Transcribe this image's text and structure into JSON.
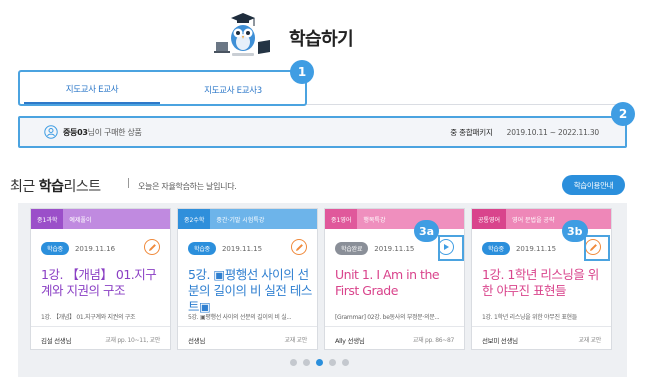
{
  "header": {
    "title": "학습하기",
    "mascot_icon": "owl-graduate-icon"
  },
  "tabs": [
    {
      "label": "지도교사 E교사",
      "active": true
    },
    {
      "label": "지도교사 E교사3",
      "active": false
    }
  ],
  "callouts": {
    "c1": "1",
    "c2": "2",
    "c3a": "3a",
    "c3b": "3b"
  },
  "info_bar": {
    "user_name": "중등03",
    "user_suffix": "님이 구매한 상품",
    "package": "중 종합패키지",
    "period": "2019.10.11 ~ 2022.11.30"
  },
  "section": {
    "title_prefix": "최근 ",
    "title_bold": "학습",
    "title_suffix": "리스트",
    "subtitle": "오늘은 자율학습하는 날입니다.",
    "guide_button": "학습이용안내"
  },
  "cards": [
    {
      "subject": "중1과학",
      "topic": "예제풀이",
      "subject_color": "#9b4fc9",
      "topic_color": "#c08ae0",
      "badge": "학습중",
      "badge_color": "#2b8fdc",
      "date": "2019.11.16",
      "action_icon": "pencil-icon",
      "title": "1강. 【개념】 01.지구계와 지권의 구조",
      "title_color": "#8a3fc4",
      "desc": "1강. 【개념】 01.지구계와 지권의 구조",
      "teacher": "김설 선생님",
      "pages": "교재 pp. 10~11, 교안"
    },
    {
      "subject": "중2수학",
      "topic": "중간·기말 시험특강",
      "subject_color": "#2f8fdb",
      "topic_color": "#6db4ea",
      "badge": "학습중",
      "badge_color": "#2b8fdc",
      "date": "2019.11.15",
      "action_icon": "pencil-icon",
      "title": "5강. ▣평행선 사이의 선분의 길이의 비 실전 테스트▣",
      "title_color": "#2f7fd0",
      "desc": "5강. ▣평행선 사이의 선분의 길이의 비 실...",
      "teacher": "선생님",
      "pages": "교재 교안"
    },
    {
      "subject": "중1영어",
      "topic": "행복특강",
      "subject_color": "#e0589b",
      "topic_color": "#ef8fbe",
      "badge": "학습완료",
      "badge_color": "#8a8f98",
      "date": "2019.11.15",
      "action_icon": "play-icon",
      "title": "Unit 1. I Am in the First Grade",
      "title_color": "#d9448c",
      "desc": "[Grammar] 02강. be동사의 부정문·의문...",
      "teacher": "Ally 선생님",
      "pages": "교재 pp. 86~87"
    },
    {
      "subject": "공통영어",
      "topic": "영어 문법을 공략",
      "subject_color": "#d9448c",
      "topic_color": "#ee87b8",
      "badge": "학습중",
      "badge_color": "#2b8fdc",
      "date": "2019.11.15",
      "action_icon": "pencil-icon",
      "title": "1강. 1학년 리스닝을 위한 야무진 표현들",
      "title_color": "#d9448c",
      "desc": "1강. 1학년 리스닝을 위한 야무진 표현들",
      "teacher": "선보미 선생님",
      "pages": "교재 교안"
    }
  ],
  "pagination": {
    "count": 5,
    "active": 3
  },
  "colors": {
    "accent": "#2b8fdc",
    "highlight": "#4ba3e0",
    "panel_bg": "#eef0f3"
  }
}
